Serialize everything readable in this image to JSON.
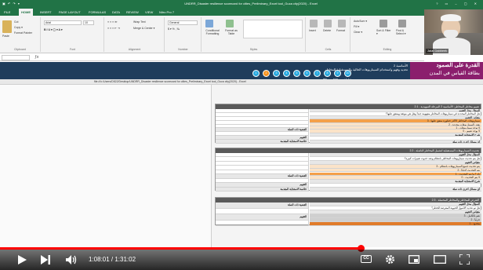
{
  "excel": {
    "quick_access": "▣ ↶ ↷ ▾",
    "window_title": "UNDRR_Disaster resilience scorecard for cities_Preliminary_Excel tool_Guca city(2020) - Excel",
    "window_controls": "? ▭ – ▢ ✕",
    "tabs": [
      "FILE",
      "HOME",
      "INSERT",
      "PAGE LAYOUT",
      "FORMULAS",
      "DATA",
      "REVIEW",
      "VIEW",
      "Nitro Pro 7"
    ],
    "active_tab": "HOME",
    "ribbon": {
      "cut": "Cut",
      "copy": "Copy ▾",
      "format_painter": "Format Painter",
      "paste": "Paste",
      "font_name": "Arial",
      "font_size": "10",
      "wrap_text": "Wrap Text",
      "merge_center": "Merge & Center ▾",
      "number_format": "General",
      "conditional_formatting": "Conditional Formatting",
      "format_as_table": "Format as Table",
      "insert": "Insert",
      "delete": "Delete",
      "format": "Format",
      "autosum": "AutoSum ▾",
      "fill": "Fill ▾",
      "clear": "Clear ▾",
      "sort_filter": "Sort & Filter ▾",
      "find_select": "Find & Select ▾",
      "groups": [
        "Clipboard",
        "Font",
        "Alignment",
        "Number",
        "Styles",
        "Cells",
        "Editing"
      ]
    }
  },
  "webcam": {
    "name": "Jalal Dabbeek"
  },
  "dashboard": {
    "title_ar": "القدرة على الصمود",
    "subtitle_ar": "بطاقة القياس في المدن",
    "desc_ar_1": "الأساسية 2",
    "desc_ar_2": "تحديد وفهم واستخدام السيناريوهات الحالية والمستقبلية للمخاطر",
    "steps": [
      "1",
      "2",
      "3",
      "4",
      "5",
      "6",
      "7",
      "8",
      "9",
      "10"
    ],
    "active_step": "2",
    "step_labels": [
      "",
      "",
      "",
      "",
      "",
      "",
      "",
      "PSI",
      "SCS",
      "تعليمات"
    ],
    "hyperlink_path": "file:///c:/Users/D522/Desktop/UNDRR_Disaster resilience scorecard for cities_Preliminary_Excel tool_Guca city(2020) - Excel"
  },
  "sheet": {
    "cards": [
      {
        "header": "تقييم مخاطر المخاطر: الأساسية 2 المرحلة التمهيدية - 2.1",
        "left_rows": [
          "",
          "",
          "",
          "",
          "",
          "القضية ذات الصلة",
          "",
          "التقييم",
          "خلاصة الاستجابة المقدمة"
        ],
        "right_rows": [
          "السؤال محل التقييم",
          "هل المخاطر المحددة في سيناريوهات المخاطر مفهومة جيداً وهل هي موثقة ومتفق عليها؟",
          "مقياس التقييم",
          "3 - سيناريوهات المخاطر الأكثر خطورة متفق عليها",
          "2 - بعض السيناريوهات محددة",
          "1 - لا توجد سيناريوهات",
          "0 - لا يوجد تقييم",
          "شرح الاستجابة المقدمة",
          "",
          "أي مسائل أخرى ذات صلة"
        ]
      },
      {
        "header": "تحديث السيناريوهات المستقبلية لتشمل المخاطر الناشئة - 2.2",
        "left_rows": [
          "",
          "",
          "",
          "",
          "",
          "القضية ذات الصلة",
          "",
          "التقييم",
          "خلاصة الاستجابة المقدمة"
        ],
        "right_rows": [
          "السؤال محل التقييم",
          "هل يتم تحديث سيناريوهات المخاطر بانتظام وعند حدوث تغييرات كبيرة؟",
          "مقياس التقييم",
          "3 - يتم تحديث جميع السيناريوهات بانتظام",
          "2 - يتم التحديث أحياناً",
          "1 - نادراً ما يتم التحديث",
          "0 - لا يتم التحديث",
          "شرح الاستجابة المقدمة",
          "",
          "أي مسائل أخرى ذات صلة"
        ]
      },
      {
        "header": "التعرض للمخاطر والمخاطر المحتملة - 2.3",
        "left_rows": [
          "القضية ذات الصلة",
          "",
          "التقييم",
          ""
        ],
        "right_rows": [
          "السؤال محل التقييم",
          "هل تم تحديد الأصول الحيوية المعرضة للخطر؟",
          "مقياس التقييم",
          "3 - نعم بالكامل",
          "2 - جزئياً",
          "1 - محدود"
        ]
      }
    ]
  },
  "player": {
    "time": "1:08:01 / 1:31:02",
    "progress": 0.747,
    "cc_label": "CC"
  }
}
